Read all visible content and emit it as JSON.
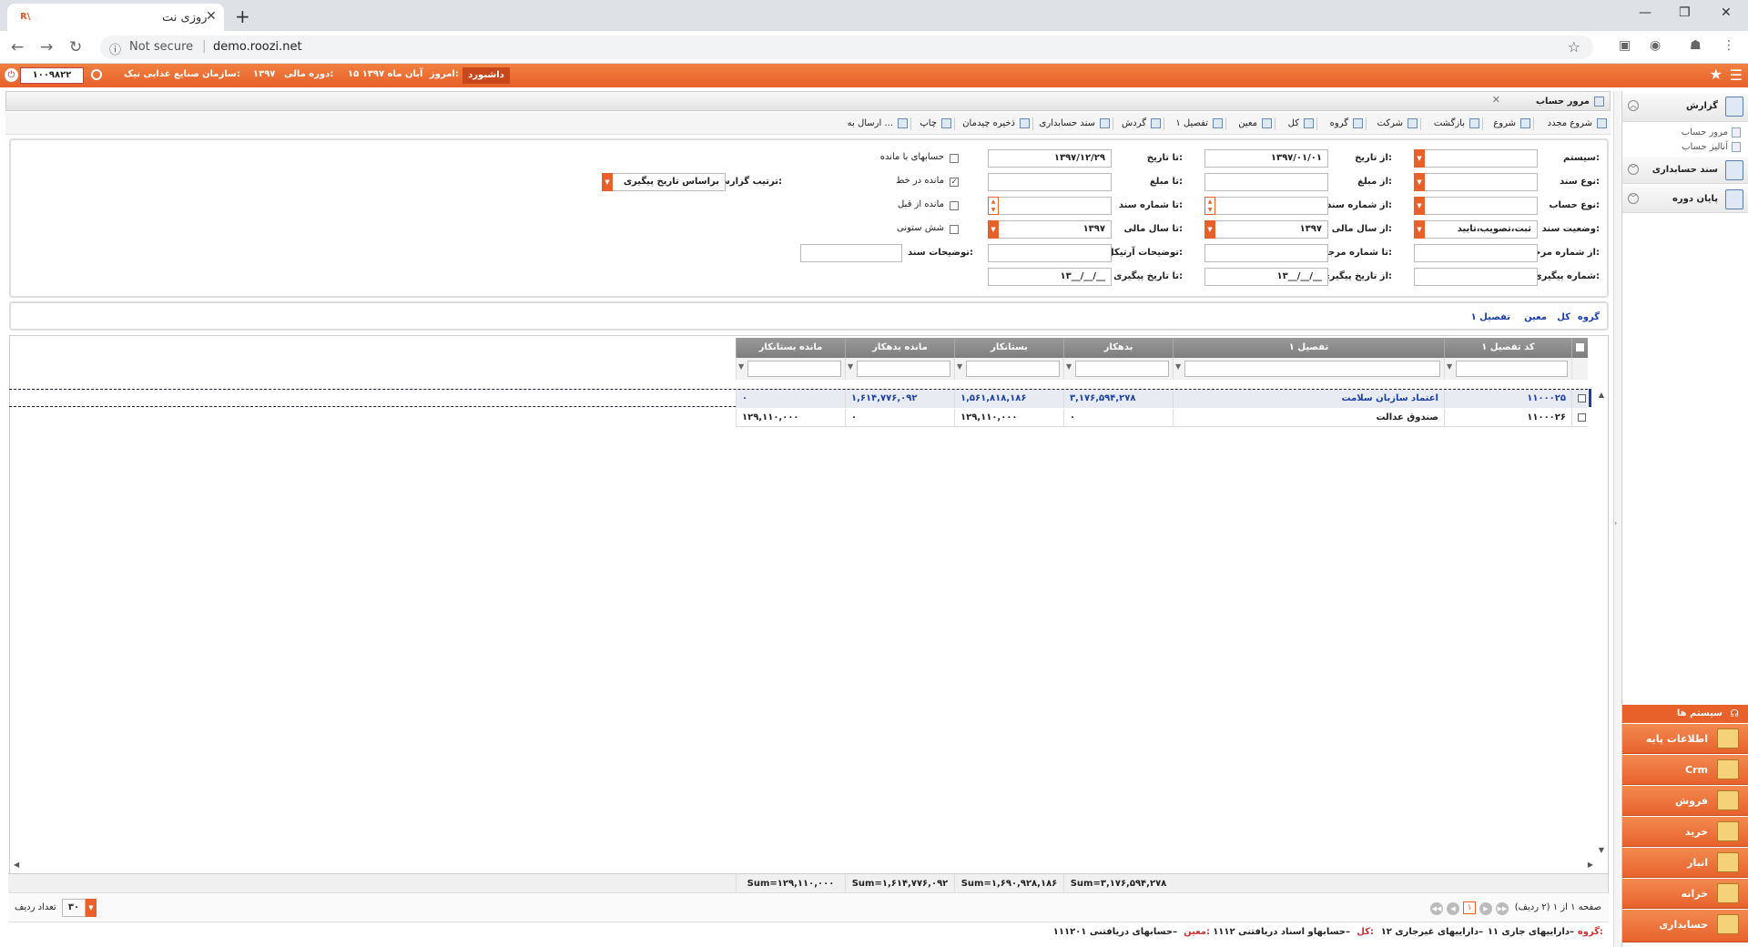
{
  "browser": {
    "tab_title": "روزی نت",
    "favicon_text": "R\\",
    "url_prefix": "Not secure",
    "url_host": "demo.roozi.net"
  },
  "header": {
    "dashboard": "داشبورد",
    "today_label": "امروز:",
    "today_value": "۱۵ آبان ماه ۱۳۹۷",
    "period_label": "دوره مالی:",
    "period_value": "۱۳۹۷",
    "org_label": "سازمان:",
    "org_value": "صنایع غذایی نیک",
    "user_code": "۱۰۰۹۸۲۲"
  },
  "window": {
    "title": "مرور حساب"
  },
  "toolbar": [
    "شروع مجدد",
    "شروع",
    "بازگشت",
    "شرکت",
    "گروه",
    "کل",
    "معین",
    "تفصیل ۱",
    "گردش",
    "سند حسابداری",
    "ذخیره چیدمان",
    "چاپ",
    "ارسال به ..."
  ],
  "form": {
    "system_label": "سیستم:",
    "doc_type_label": "نوع سند:",
    "acc_type_label": "نوع حساب:",
    "doc_status_label": "وضعیت سند:",
    "doc_status_value": "ثبت،تصویب،تایید",
    "ref_from_label": "از شماره مرجع:",
    "track_no_label": "شماره پیگیری:",
    "from_date_label": "از تاریخ:",
    "from_date_value": "۱۳۹۷/۰۱/۰۱",
    "from_amount_label": "از مبلغ:",
    "from_docno_label": "از شماره سند:",
    "from_year_label": "از سال مالی:",
    "from_year_value": "۱۳۹۷",
    "ref_to_label": "تا شماره مرجع:",
    "from_track_date_label": "از تاریخ پیگیری:",
    "from_track_date_value": "۱۳__/__/__",
    "to_date_label": "تا تاریخ:",
    "to_date_value": "۱۳۹۷/۱۲/۲۹",
    "to_amount_label": "تا مبلغ:",
    "to_docno_label": "تا شماره سند:",
    "to_year_label": "تا سال مالی:",
    "to_year_value": "۱۳۹۷",
    "article_desc_label": "توضیحات آرتیکل:",
    "to_track_date_label": "تا تاریخ پیگیری:",
    "to_track_date_value": "۱۳__/__/__",
    "doc_desc_label": "توضیحات سند:",
    "chk_with_balance": "حسابهای با مانده",
    "chk_balance_inline": "مانده در خط",
    "chk_prev_balance": "مانده از قبل",
    "chk_six_column": "شش ستونی",
    "order_label": "ترتیب گزارش:",
    "order_value": "براساس تاریخ پیگیری"
  },
  "breadcrumb": [
    "گروه",
    "کل",
    "معین",
    "تفصیل ۱"
  ],
  "grid": {
    "columns": [
      "کد تفصیل ۱",
      "تفصیل ۱",
      "بدهکار",
      "بستانکار",
      "مانده بدهکار",
      "مانده بستانکار"
    ],
    "rows": [
      [
        "۱۱۰۰۰۲۵",
        "اعتماد سازبان سلامت",
        "۳,۱۷۶,۵۹۴,۲۷۸",
        "۱,۵۶۱,۸۱۸,۱۸۶",
        "۱,۶۱۴,۷۷۶,۰۹۲",
        "۰"
      ],
      [
        "۱۱۰۰۰۲۶",
        "صندوق عدالت",
        "۰",
        "۱۲۹,۱۱۰,۰۰۰",
        "۰",
        "۱۲۹,۱۱۰,۰۰۰"
      ]
    ],
    "sums": [
      "Sum=۳,۱۷۶,۵۹۴,۲۷۸",
      "Sum=۱,۶۹۰,۹۲۸,۱۸۶",
      "Sum=۱,۶۱۴,۷۷۶,۰۹۲",
      "Sum=۱۲۹,۱۱۰,۰۰۰"
    ]
  },
  "pager": {
    "page_info": "صفحه ۱ از ۱ (۲ ردیف)",
    "current_page": "۱",
    "row_count_label": "تعداد ردیف",
    "row_count_value": "۳۰"
  },
  "status_path": {
    "group_label": "گروه:",
    "group_value": "۱۱ داراییهای جاری–",
    "mid": "۱۲ داراییهای غیرجاری–",
    "kol_label": "کل:",
    "kol_value": "۱۱۱۲ حسابهاو اسناد دریافتنی–",
    "moin_label": "معین:",
    "moin_value": "۱۱۱۲۰۱ حسابهای دریافتنی–"
  },
  "sidebar": {
    "sections": [
      {
        "label": "گزارش",
        "subs": [
          "مرور حساب",
          "آنالیز حساب"
        ]
      },
      {
        "label": "سند حسابداری"
      },
      {
        "label": "پایان دوره"
      }
    ],
    "systems_header": "سیستم ها",
    "systems": [
      "اطلاعات پایه",
      "Crm",
      "فروش",
      "خرید",
      "انبار",
      "خزانه",
      "حسابداری"
    ]
  },
  "colors": {
    "accent": "#e8602a",
    "link": "#1a3fa8",
    "grid_header": "#8a8a8a"
  }
}
